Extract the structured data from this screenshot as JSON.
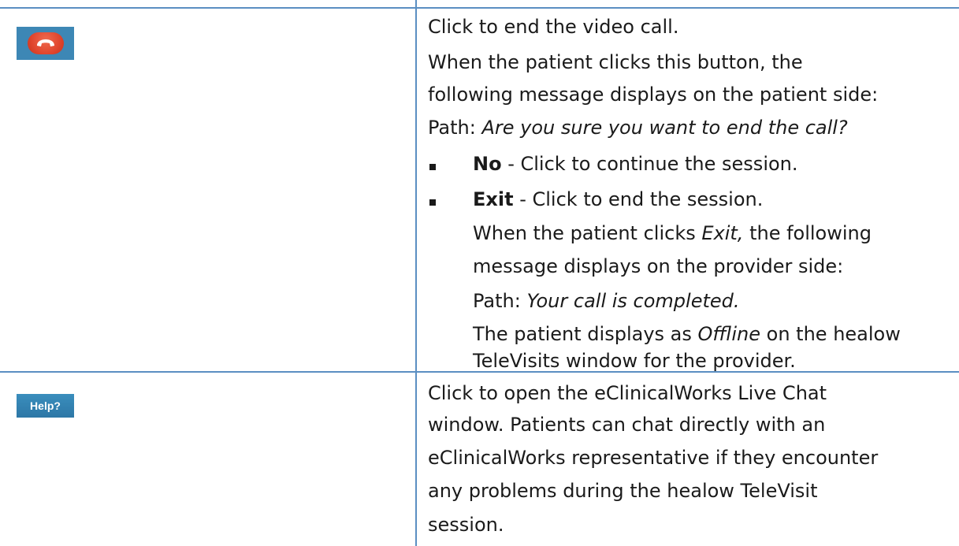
{
  "rows": [
    {
      "icon": "end-call-icon",
      "lines": [
        "Click to end the video call.",
        "When the patient clicks this button, the",
        "following message displays on the patient side:"
      ],
      "path_label": "Path:",
      "path_message": "Are you sure you want to end the call?",
      "options": [
        {
          "name": "No",
          "desc": " - Click to continue the session."
        },
        {
          "name": "Exit",
          "desc": " - Click to end the session."
        }
      ],
      "exit_note": {
        "pre": "When the patient clicks ",
        "em": "Exit,",
        "post": " the following",
        "line2": "message displays on the provider side:",
        "path_label": "Path:",
        "path_message": "Your call is completed.",
        "status_pre": "The patient displays as ",
        "status_em": "Offline",
        "status_post": " on the healow",
        "status_line2": "TeleVisits window for the provider."
      }
    },
    {
      "icon_label": "Help?",
      "lines": [
        "Click to open the eClinicalWorks Live Chat",
        "window. Patients can chat directly with an",
        "eClinicalWorks representative if they encounter",
        "any problems during the healow TeleVisit",
        "session."
      ]
    }
  ]
}
